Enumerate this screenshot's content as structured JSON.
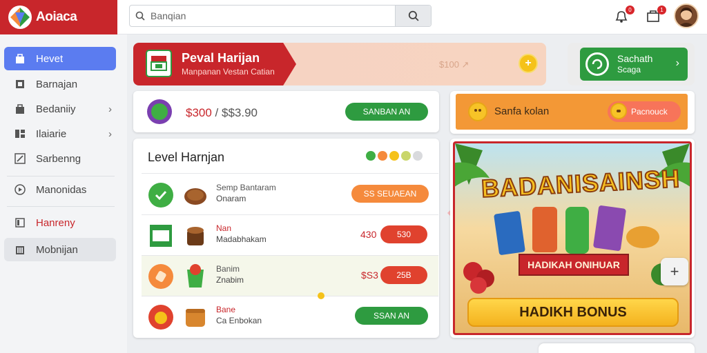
{
  "app": {
    "logo_text": "Aoiaca"
  },
  "search": {
    "placeholder": "Banqian"
  },
  "header": {
    "notification_count": "0",
    "cart_count": "1"
  },
  "sidebar": {
    "items": [
      {
        "label": "Hevet",
        "icon": "bag-icon"
      },
      {
        "label": "Barnajan",
        "icon": "square-icon"
      },
      {
        "label": "Bedaniiy",
        "icon": "bag-icon"
      },
      {
        "label": "Ilaiarie",
        "icon": "grid-icon"
      },
      {
        "label": "Sarbenng",
        "icon": "edit-icon"
      },
      {
        "label": "Manonidas",
        "icon": "play-icon"
      },
      {
        "label": "Hanreny",
        "icon": "card-icon"
      },
      {
        "label": "Mobnijan",
        "icon": "building-icon"
      }
    ]
  },
  "banner": {
    "title": "Peval Harijan",
    "subtitle": "Manpanan Vestan Catian",
    "price": "$100 ↗"
  },
  "search_card": {
    "label_line1": "Sachath",
    "label_line2": "Scaga"
  },
  "price_card": {
    "price": "$300",
    "sep": " / ",
    "alt_price": "$$3.90",
    "button": "SANBAN AN"
  },
  "level": {
    "title": "Level Harnjan",
    "dot_colors": [
      "#3fae44",
      "#f58a3c",
      "#f5c21a",
      "#c9d66a",
      "#d9dadd"
    ],
    "rows": [
      {
        "line1": "Semp Bantaram",
        "line2": "Onaram",
        "amount": "",
        "button": "SS SEUAEAN",
        "button_style": "orange"
      },
      {
        "line1": "Nan",
        "line2": "Madabhakam",
        "amount": "430",
        "button": "530",
        "button_style": "red"
      },
      {
        "line1": "Banim",
        "line2": "Znabim",
        "amount": "$S3",
        "button": "25B",
        "button_style": "red"
      },
      {
        "line1": "Bane",
        "line2": "Ca Enbokan",
        "amount": "",
        "button": "SSAN AN",
        "button_style": "green"
      }
    ]
  },
  "promo": {
    "text": "Sanfa kolan",
    "button": "Pacnouck"
  },
  "game": {
    "title": "BADANISAINSH",
    "ribbon": "HADIKAH ONIHUAR",
    "bonus_button": "HADIKH BONUS"
  },
  "colors": {
    "brand_red": "#c8262b",
    "accent_green": "#2e9b40",
    "active_blue": "#5b7cf0",
    "promo_orange": "#f39836"
  }
}
